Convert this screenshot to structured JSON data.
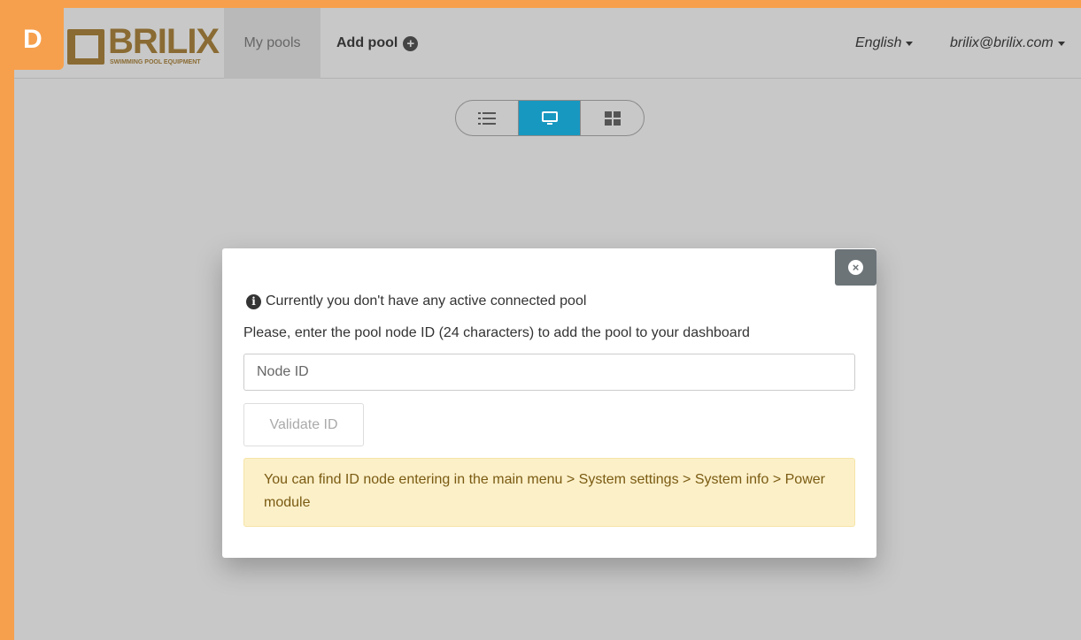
{
  "badge": {
    "letter": "D"
  },
  "brand": {
    "name": "BRILIX",
    "tagline": "SWIMMING POOL EQUIPMENT"
  },
  "nav": {
    "my_pools": "My pools",
    "add_pool": "Add pool",
    "language": "English",
    "user": "brilix@brilix.com"
  },
  "view_toggle": {
    "options": [
      "list-icon",
      "monitor-icon",
      "grid-icon"
    ],
    "active": "monitor-icon",
    "active_color": "#1798c1"
  },
  "modal": {
    "info_text": "Currently you don't have any active connected pool",
    "instruction": "Please, enter the pool node ID (24 characters) to add the pool to your dashboard",
    "input_placeholder": "Node ID",
    "input_value": "",
    "validate_label": "Validate ID",
    "hint": "You can find ID node entering in the main menu > System settings > System info > Power module"
  },
  "colors": {
    "frame": "#f6a04d",
    "brand": "#8a6b33",
    "hint_bg": "#fcf0c9",
    "close_bg": "#6c7478"
  }
}
